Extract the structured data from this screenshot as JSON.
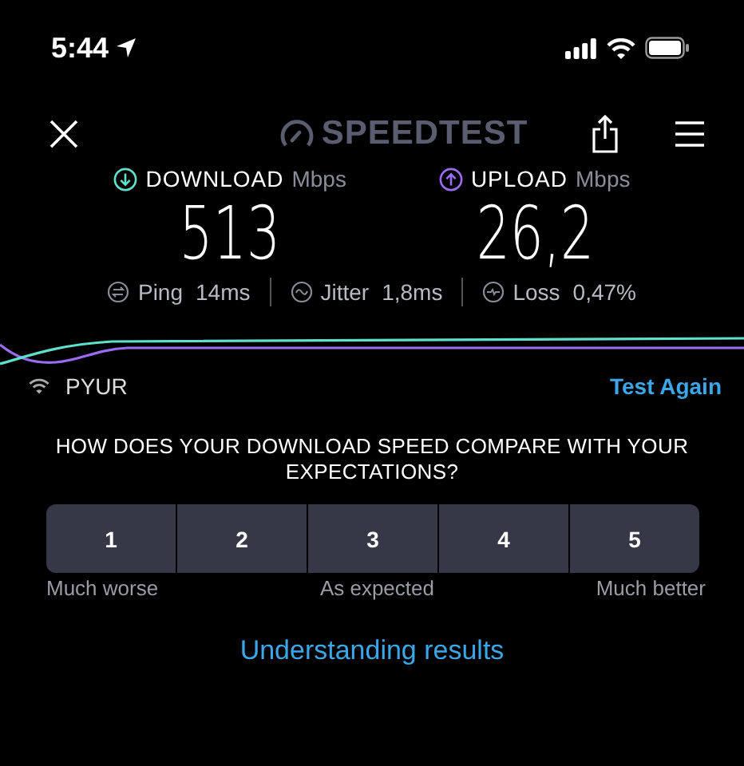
{
  "status_bar": {
    "time": "5:44"
  },
  "header": {
    "logo": "SPEEDTEST"
  },
  "results": [
    {
      "kind": "download",
      "label": "DOWNLOAD",
      "unit": "Mbps",
      "value": "513"
    },
    {
      "kind": "upload",
      "label": "UPLOAD",
      "unit": "Mbps",
      "value": "26,2"
    }
  ],
  "stats": [
    {
      "kind": "ping",
      "label": "Ping",
      "value": "14ms"
    },
    {
      "kind": "jitter",
      "label": "Jitter",
      "value": "1,8ms"
    },
    {
      "kind": "loss",
      "label": "Loss",
      "value": "0,47%"
    }
  ],
  "network": {
    "name": "PYUR",
    "action": "Test Again"
  },
  "survey": {
    "question": "HOW DOES YOUR DOWNLOAD SPEED COMPARE WITH YOUR EXPECTATIONS?",
    "options": [
      {
        "label": "1",
        "selected": false
      },
      {
        "label": "2",
        "selected": false
      },
      {
        "label": "3",
        "selected": false
      },
      {
        "label": "4",
        "selected": false
      },
      {
        "label": "5",
        "selected": false
      }
    ],
    "scale_labels": [
      "Much worse",
      "As expected",
      "Much better"
    ]
  },
  "link": "Understanding results"
}
